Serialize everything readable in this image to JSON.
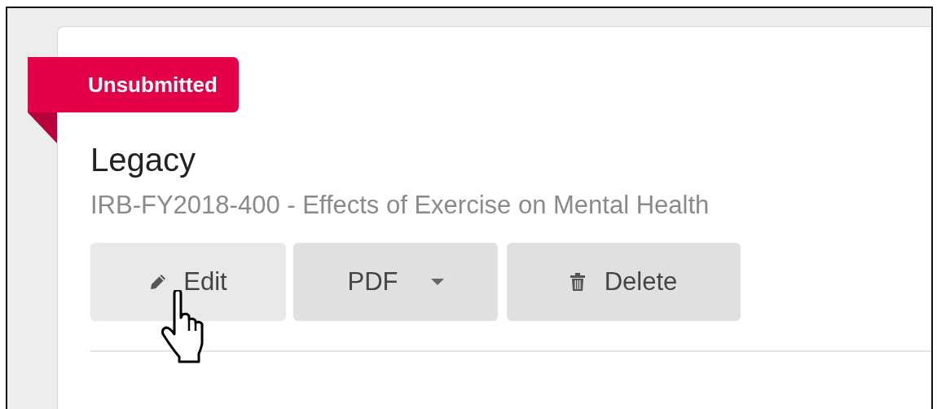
{
  "status_ribbon": {
    "label": "Unsubmitted"
  },
  "card": {
    "title": "Legacy",
    "subtitle": "IRB-FY2018-400 - Effects of Exercise on Mental Health"
  },
  "buttons": [
    {
      "kind": "edit",
      "label": "Edit",
      "hovered": true
    },
    {
      "kind": "dropdown",
      "label": "PDF",
      "hovered": false
    },
    {
      "kind": "delete",
      "label": "Delete",
      "hovered": false
    }
  ]
}
